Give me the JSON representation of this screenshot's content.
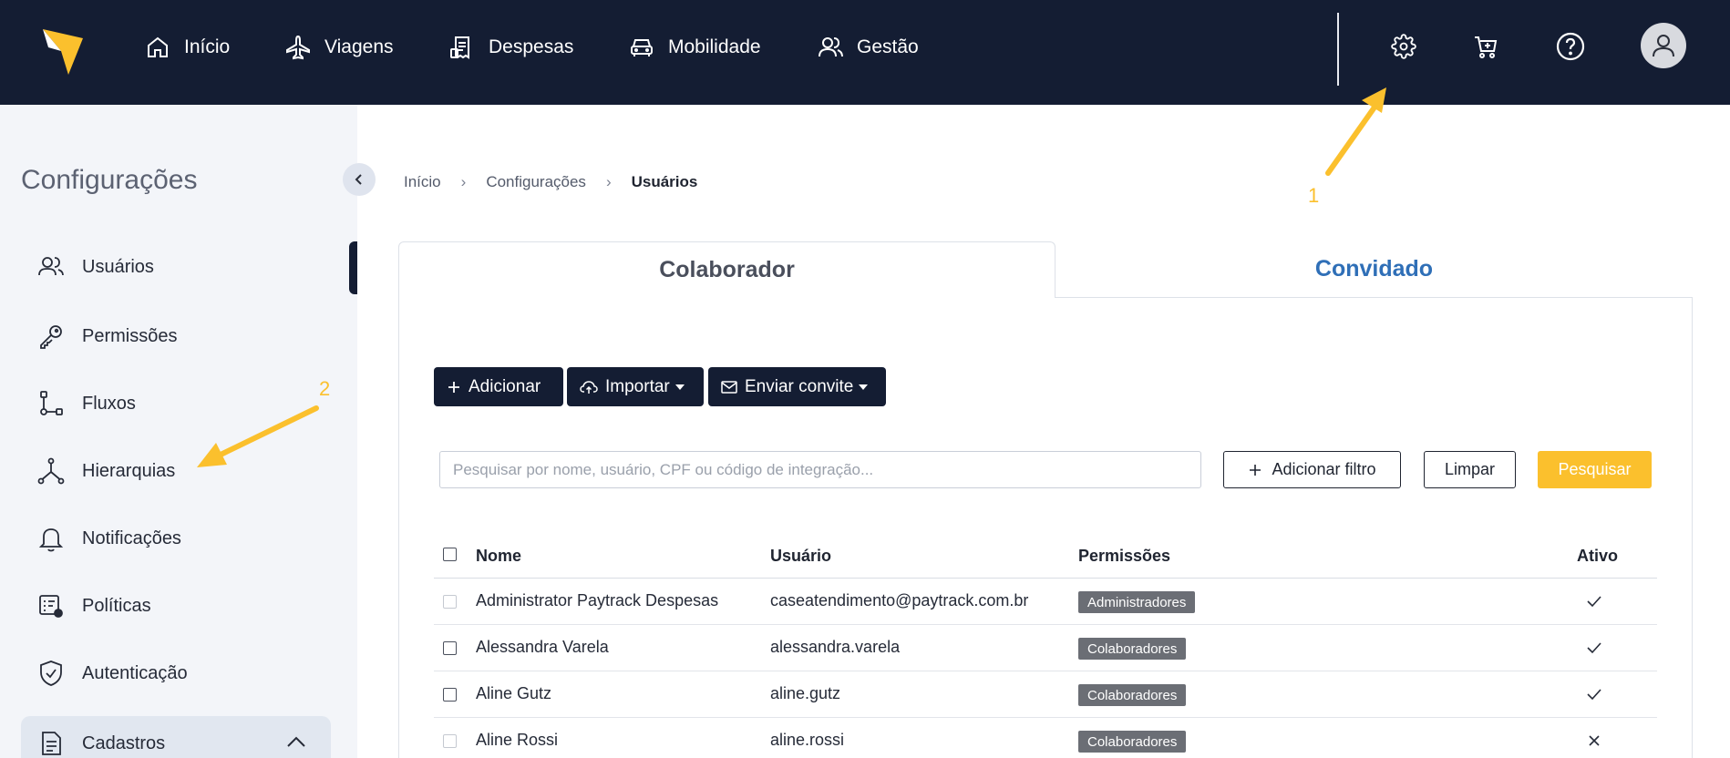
{
  "topbar": {
    "nav": [
      {
        "label": "Início",
        "icon": "home-icon"
      },
      {
        "label": "Viagens",
        "icon": "airplane-icon"
      },
      {
        "label": "Despesas",
        "icon": "receipt-icon"
      },
      {
        "label": "Mobilidade",
        "icon": "car-icon"
      },
      {
        "label": "Gestão",
        "icon": "users-icon"
      }
    ],
    "actions": [
      "gear-icon",
      "cart-plus-icon",
      "help-icon",
      "avatar-icon"
    ],
    "background": "#141d33",
    "logo_color": "#fbc02d"
  },
  "sidebar": {
    "title": "Configurações",
    "items": [
      {
        "label": "Usuários",
        "icon": "users-icon",
        "active": true
      },
      {
        "label": "Permissões",
        "icon": "key-icon"
      },
      {
        "label": "Fluxos",
        "icon": "flow-icon"
      },
      {
        "label": "Hierarquias",
        "icon": "hierarchy-icon"
      },
      {
        "label": "Notificações",
        "icon": "bell-icon"
      },
      {
        "label": "Políticas",
        "icon": "policy-icon"
      },
      {
        "label": "Autenticação",
        "icon": "shield-icon"
      },
      {
        "label": "Cadastros",
        "icon": "document-icon",
        "expanded": true
      }
    ]
  },
  "breadcrumb": {
    "items": [
      "Início",
      "Configurações",
      "Usuários"
    ]
  },
  "tabs": [
    {
      "label": "Colaborador",
      "active": true
    },
    {
      "label": "Convidado",
      "active": false
    }
  ],
  "toolbar": {
    "add_label": "Adicionar",
    "import_label": "Importar",
    "invite_label": "Enviar convite"
  },
  "search": {
    "placeholder": "Pesquisar por nome, usuário, CPF ou código de integração...",
    "value": "",
    "add_filter_label": "Adicionar filtro",
    "clear_label": "Limpar",
    "search_label": "Pesquisar"
  },
  "table": {
    "columns": [
      "Nome",
      "Usuário",
      "Permissões",
      "Ativo"
    ],
    "rows": [
      {
        "name": "Administrator Paytrack Despesas",
        "user": "caseatendimento@paytrack.com.br",
        "permission": "Administradores",
        "active": true,
        "selectable": false
      },
      {
        "name": "Alessandra Varela",
        "user": "alessandra.varela",
        "permission": "Colaboradores",
        "active": true,
        "selectable": true
      },
      {
        "name": "Aline Gutz",
        "user": "aline.gutz",
        "permission": "Colaboradores",
        "active": true,
        "selectable": true
      },
      {
        "name": "Aline Rossi",
        "user": "aline.rossi",
        "permission": "Colaboradores",
        "active": false,
        "selectable": false
      }
    ]
  },
  "annotations": {
    "step1": "1",
    "step2": "2",
    "color": "#fbc02d"
  }
}
